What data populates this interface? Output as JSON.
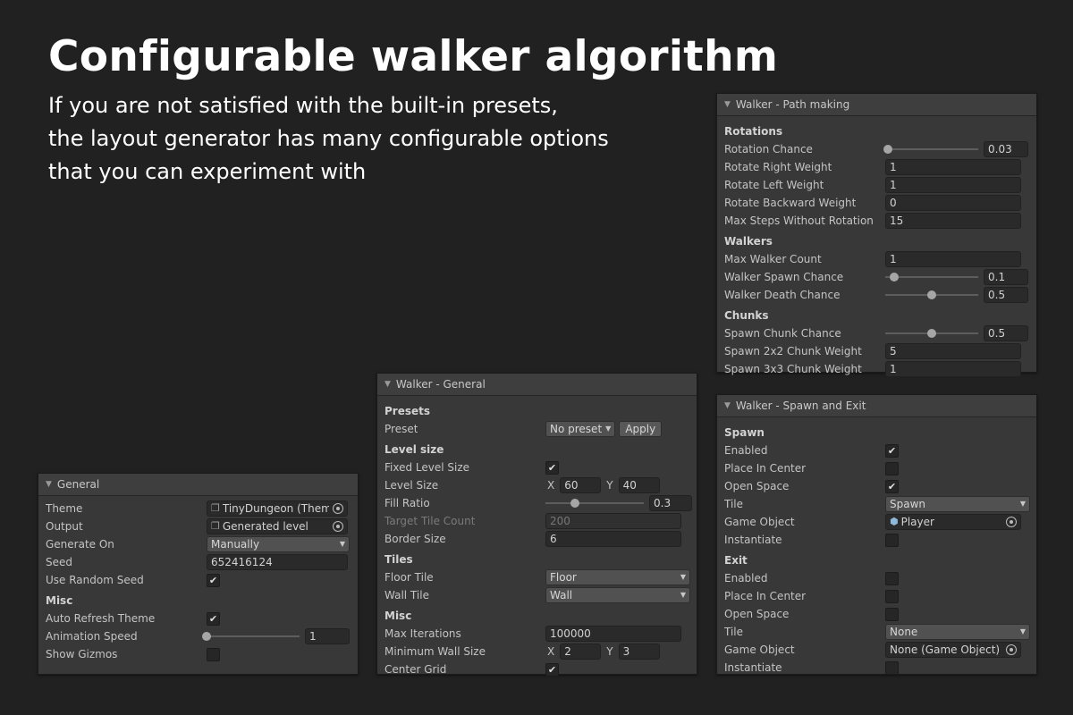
{
  "hero": {
    "title": "Configurable walker algorithm",
    "subtitle_lines": [
      "If you are not satisfied with the built-in presets,",
      "the layout generator has many configurable options",
      "that you can experiment with"
    ]
  },
  "general": {
    "header": "General",
    "theme": {
      "label": "Theme",
      "value": "TinyDungeon (Theme)",
      "icon": "scriptable-object-icon"
    },
    "output": {
      "label": "Output",
      "value": "Generated level",
      "icon": "cube-icon"
    },
    "generate_on": {
      "label": "Generate On",
      "value": "Manually"
    },
    "seed": {
      "label": "Seed",
      "value": "652416124"
    },
    "use_random_seed": {
      "label": "Use Random Seed",
      "checked": true
    },
    "misc_header": "Misc",
    "auto_refresh_theme": {
      "label": "Auto Refresh Theme",
      "checked": true
    },
    "animation_speed": {
      "label": "Animation Speed",
      "value": "1",
      "fraction": 0.0
    },
    "show_gizmos": {
      "label": "Show Gizmos",
      "checked": false
    }
  },
  "walker_general": {
    "header": "Walker - General",
    "presets_header": "Presets",
    "preset": {
      "label": "Preset",
      "value": "No preset",
      "apply_label": "Apply"
    },
    "level_size_header": "Level size",
    "fixed_level_size": {
      "label": "Fixed Level Size",
      "checked": true
    },
    "level_size": {
      "label": "Level Size",
      "x_label": "X",
      "x": "60",
      "y_label": "Y",
      "y": "40"
    },
    "fill_ratio": {
      "label": "Fill Ratio",
      "value": "0.3",
      "fraction": 0.3
    },
    "target_tile_count": {
      "label": "Target Tile Count",
      "value": "200"
    },
    "border_size": {
      "label": "Border Size",
      "value": "6"
    },
    "tiles_header": "Tiles",
    "floor_tile": {
      "label": "Floor Tile",
      "value": "Floor"
    },
    "wall_tile": {
      "label": "Wall Tile",
      "value": "Wall"
    },
    "misc_header": "Misc",
    "max_iterations": {
      "label": "Max Iterations",
      "value": "100000"
    },
    "min_wall_size": {
      "label": "Minimum Wall Size",
      "x_label": "X",
      "x": "2",
      "y_label": "Y",
      "y": "3"
    },
    "center_grid": {
      "label": "Center Grid",
      "checked": true
    }
  },
  "walker_path": {
    "header": "Walker - Path making",
    "rotations_header": "Rotations",
    "rotation_chance": {
      "label": "Rotation Chance",
      "value": "0.03",
      "fraction": 0.03
    },
    "rotate_right_weight": {
      "label": "Rotate Right Weight",
      "value": "1"
    },
    "rotate_left_weight": {
      "label": "Rotate Left Weight",
      "value": "1"
    },
    "rotate_backward_weight": {
      "label": "Rotate Backward Weight",
      "value": "0"
    },
    "max_steps_without_rotation": {
      "label": "Max Steps Without Rotation",
      "value": "15"
    },
    "walkers_header": "Walkers",
    "max_walker_count": {
      "label": "Max Walker Count",
      "value": "1"
    },
    "walker_spawn_chance": {
      "label": "Walker Spawn Chance",
      "value": "0.1",
      "fraction": 0.1
    },
    "walker_death_chance": {
      "label": "Walker Death Chance",
      "value": "0.5",
      "fraction": 0.5
    },
    "chunks_header": "Chunks",
    "spawn_chunk_chance": {
      "label": "Spawn Chunk Chance",
      "value": "0.5",
      "fraction": 0.5
    },
    "spawn_2x2_chunk_weight": {
      "label": "Spawn 2x2 Chunk Weight",
      "value": "5"
    },
    "spawn_3x3_chunk_weight": {
      "label": "Spawn 3x3 Chunk Weight",
      "value": "1"
    }
  },
  "walker_spawn_exit": {
    "header": "Walker - Spawn and Exit",
    "spawn_header": "Spawn",
    "spawn": {
      "enabled": {
        "label": "Enabled",
        "checked": true
      },
      "place_in_center": {
        "label": "Place In Center",
        "checked": false
      },
      "open_space": {
        "label": "Open Space",
        "checked": true
      },
      "tile": {
        "label": "Tile",
        "value": "Spawn"
      },
      "game_object": {
        "label": "Game Object",
        "value": "Player",
        "icon": "prefab-icon"
      },
      "instantiate": {
        "label": "Instantiate",
        "checked": false
      }
    },
    "exit_header": "Exit",
    "exit": {
      "enabled": {
        "label": "Enabled",
        "checked": false
      },
      "place_in_center": {
        "label": "Place In Center",
        "checked": false
      },
      "open_space": {
        "label": "Open Space",
        "checked": false
      },
      "tile": {
        "label": "Tile",
        "value": "None"
      },
      "game_object": {
        "label": "Game Object",
        "value": "None (Game Object)"
      },
      "instantiate": {
        "label": "Instantiate",
        "checked": false
      }
    }
  },
  "colors": {
    "background": "#212121",
    "panel": "#383838",
    "panel_header": "#3e3e3e",
    "text": "#c4c4c4",
    "hero_text": "#ffffff",
    "prefab_icon": "#8fb7d8"
  }
}
